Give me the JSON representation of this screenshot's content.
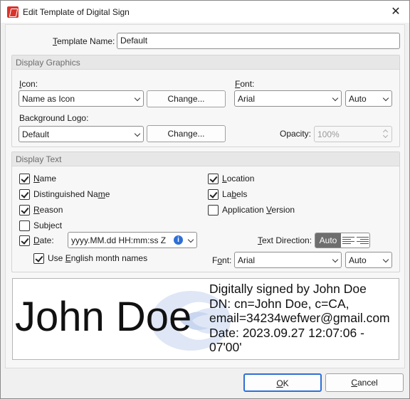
{
  "window": {
    "title": "Edit Template of Digital Sign",
    "close_glyph": "✕"
  },
  "template_name": {
    "label_pre": "",
    "label_ul": "T",
    "label_post": "emplate Name:",
    "value": "Default"
  },
  "display_graphics": {
    "header": "Display Graphics",
    "icon": {
      "label_ul": "I",
      "label_post": "con:",
      "value": "Name as Icon",
      "change_label": "Change..."
    },
    "font": {
      "label_ul": "F",
      "label_post": "ont:",
      "value": "Arial",
      "size": "Auto"
    },
    "background_logo": {
      "label": "Background Logo:",
      "value": "Default",
      "change_label": "Change..."
    },
    "opacity": {
      "label": "Opacity:",
      "value": "100%"
    }
  },
  "display_text": {
    "header": "Display Text",
    "name": {
      "ul": "N",
      "post": "ame",
      "checked": true
    },
    "distinguished_name": {
      "pre": "Distinguished Na",
      "ul": "m",
      "post": "e",
      "checked": true
    },
    "reason": {
      "ul": "R",
      "post": "eason",
      "checked": true
    },
    "subject": {
      "label": "Subject",
      "checked": false
    },
    "date": {
      "ul": "D",
      "post": "ate:",
      "checked": true,
      "format": "yyyy.MM.dd HH:mm:ss Z"
    },
    "english_months": {
      "pre": "Use ",
      "ul": "E",
      "post": "nglish month names",
      "checked": true
    },
    "location": {
      "ul": "L",
      "post": "ocation",
      "checked": true
    },
    "labels": {
      "pre": "La",
      "ul": "b",
      "post": "els",
      "checked": true
    },
    "application_version": {
      "pre": "Application ",
      "ul": "V",
      "post": "ersion",
      "checked": false
    },
    "text_direction": {
      "ul": "T",
      "post": "ext Direction:",
      "auto_label": "Auto"
    },
    "font": {
      "pre": "F",
      "ul": "o",
      "post": "nt:",
      "value": "Arial",
      "size": "Auto"
    }
  },
  "preview": {
    "name": "John Doe",
    "lines": [
      "Digitally signed by John Doe",
      "DN: cn=John Doe, c=CA,",
      "email=34234wefwer@gmail.com",
      "Date: 2023.09.27 12:07:06 -",
      "07'00'"
    ]
  },
  "buttons": {
    "ok_ul": "O",
    "ok_post": "K",
    "cancel_ul": "C",
    "cancel_post": "ancel"
  },
  "colors": {
    "accent": "#2f6fd6",
    "app_icon": "#d9342b",
    "auto_seg": "#6e6e6e"
  }
}
